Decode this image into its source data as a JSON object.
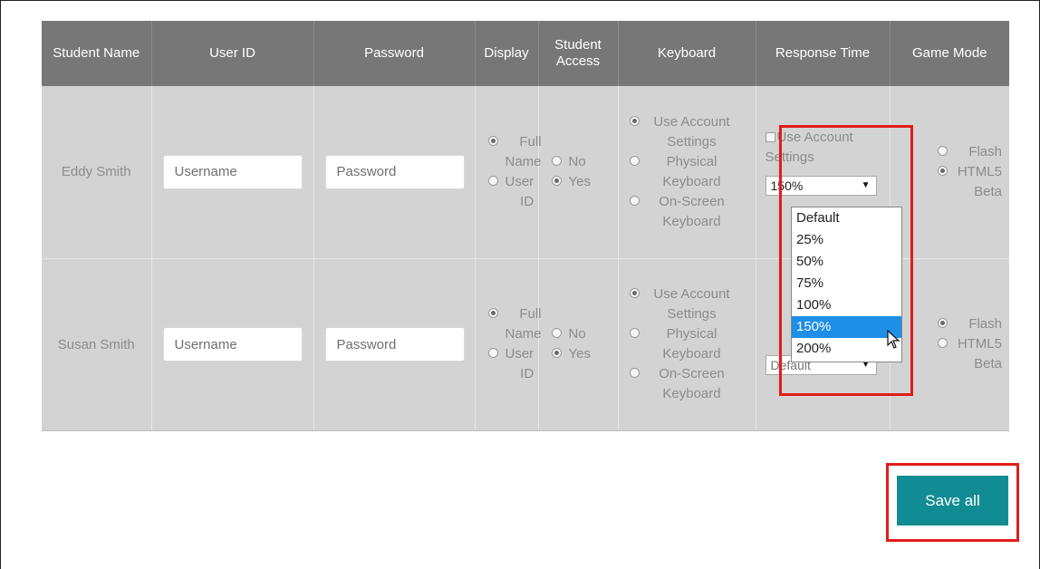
{
  "colors": {
    "header_bg": "#777777",
    "cell_bg": "#d3d3d3",
    "highlight": "#e21c1c",
    "save_button": "#128c94",
    "selected_option": "#1e8fe8"
  },
  "headers": [
    "Student Name",
    "User ID",
    "Password",
    "Display",
    "Student Access",
    "Keyboard",
    "Response Time",
    "Game Mode"
  ],
  "students": [
    {
      "name": "Eddy Smith",
      "user_id_placeholder": "Username",
      "password_placeholder": "Password",
      "display": {
        "options": [
          "Full Name",
          "User ID"
        ],
        "selected": "Full Name"
      },
      "access": {
        "options": [
          "No",
          "Yes"
        ],
        "selected": "Yes"
      },
      "keyboard": {
        "options": [
          "Use Account Settings",
          "Physical Keyboard",
          "On-Screen Keyboard"
        ],
        "selected": "Use Account Settings"
      },
      "response_time": {
        "use_account_label": "Use Account",
        "settings_label": "Settings",
        "checked": false,
        "value": "150%"
      },
      "game_mode": {
        "options": [
          "Flash",
          "HTML5 Beta"
        ],
        "selected": "HTML5 Beta"
      }
    },
    {
      "name": "Susan Smith",
      "user_id_placeholder": "Username",
      "password_placeholder": "Password",
      "display": {
        "options": [
          "Full Name",
          "User ID"
        ],
        "selected": "Full Name"
      },
      "access": {
        "options": [
          "No",
          "Yes"
        ],
        "selected": "Yes"
      },
      "keyboard": {
        "options": [
          "Use Account Settings",
          "Physical Keyboard",
          "On-Screen Keyboard"
        ],
        "selected": "Use Account Settings"
      },
      "response_time": {
        "value": "Default"
      },
      "game_mode": {
        "options": [
          "Flash",
          "HTML5 Beta"
        ],
        "selected": "Flash"
      }
    }
  ],
  "dropdown": {
    "options": [
      "Default",
      "25%",
      "50%",
      "75%",
      "100%",
      "150%",
      "200%"
    ],
    "highlighted": "150%"
  },
  "icons": {
    "cursor": "mouse-pointer-icon",
    "select_arrow": "dropdown-arrow-icon"
  },
  "save_label": "Save all"
}
